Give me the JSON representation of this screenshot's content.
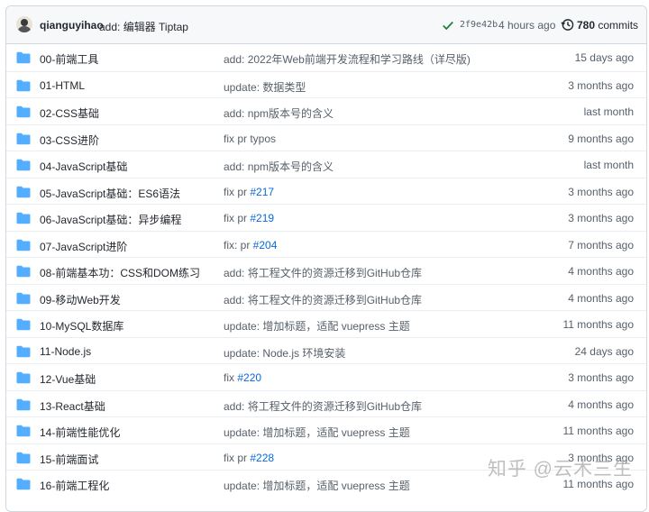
{
  "latest_commit": {
    "author": "qianguyihao",
    "message": "add: 编辑器 Tiptap",
    "sha": "2f9e42b",
    "time": "4 hours ago",
    "commit_count": "780",
    "commits_label": "commits"
  },
  "files": [
    {
      "name": "00-前端工具",
      "message": "add: 2022年Web前端开发流程和学习路线（详尽版)",
      "pr": "",
      "age": "15 days ago"
    },
    {
      "name": "01-HTML",
      "message": "update: 数据类型",
      "pr": "",
      "age": "3 months ago"
    },
    {
      "name": "02-CSS基础",
      "message": "add: npm版本号的含义",
      "pr": "",
      "age": "last month"
    },
    {
      "name": "03-CSS进阶",
      "message": "fix pr typos",
      "pr": "",
      "age": "9 months ago"
    },
    {
      "name": "04-JavaScript基础",
      "message": "add: npm版本号的含义",
      "pr": "",
      "age": "last month"
    },
    {
      "name": "05-JavaScript基础：ES6语法",
      "message": "fix pr ",
      "pr": "#217",
      "age": "3 months ago"
    },
    {
      "name": "06-JavaScript基础：异步编程",
      "message": "fix pr ",
      "pr": "#219",
      "age": "3 months ago"
    },
    {
      "name": "07-JavaScript进阶",
      "message": "fix: pr ",
      "pr": "#204",
      "age": "7 months ago"
    },
    {
      "name": "08-前端基本功：CSS和DOM练习",
      "message": "add: 将工程文件的资源迁移到GitHub仓库",
      "pr": "",
      "age": "4 months ago"
    },
    {
      "name": "09-移动Web开发",
      "message": "add: 将工程文件的资源迁移到GitHub仓库",
      "pr": "",
      "age": "4 months ago"
    },
    {
      "name": "10-MySQL数据库",
      "message": "update: 增加标题，适配 vuepress 主题",
      "pr": "",
      "age": "11 months ago"
    },
    {
      "name": "11-Node.js",
      "message": "update: Node.js 环境安装",
      "pr": "",
      "age": "24 days ago"
    },
    {
      "name": "12-Vue基础",
      "message": "fix ",
      "pr": "#220",
      "age": "3 months ago"
    },
    {
      "name": "13-React基础",
      "message": "add: 将工程文件的资源迁移到GitHub仓库",
      "pr": "",
      "age": "4 months ago"
    },
    {
      "name": "14-前端性能优化",
      "message": "update: 增加标题，适配 vuepress 主题",
      "pr": "",
      "age": "11 months ago"
    },
    {
      "name": "15-前端面试",
      "message": "fix pr ",
      "pr": "#228",
      "age": "3 months ago"
    },
    {
      "name": "16-前端工程化",
      "message": "update: 增加标题，适配 vuepress 主题",
      "pr": "",
      "age": "11 months ago"
    }
  ],
  "watermark": "知乎 @云木三生",
  "colors": {
    "folder": "#54aeff",
    "link": "#0969da",
    "check": "#1a7f37",
    "muted": "#57606a"
  }
}
